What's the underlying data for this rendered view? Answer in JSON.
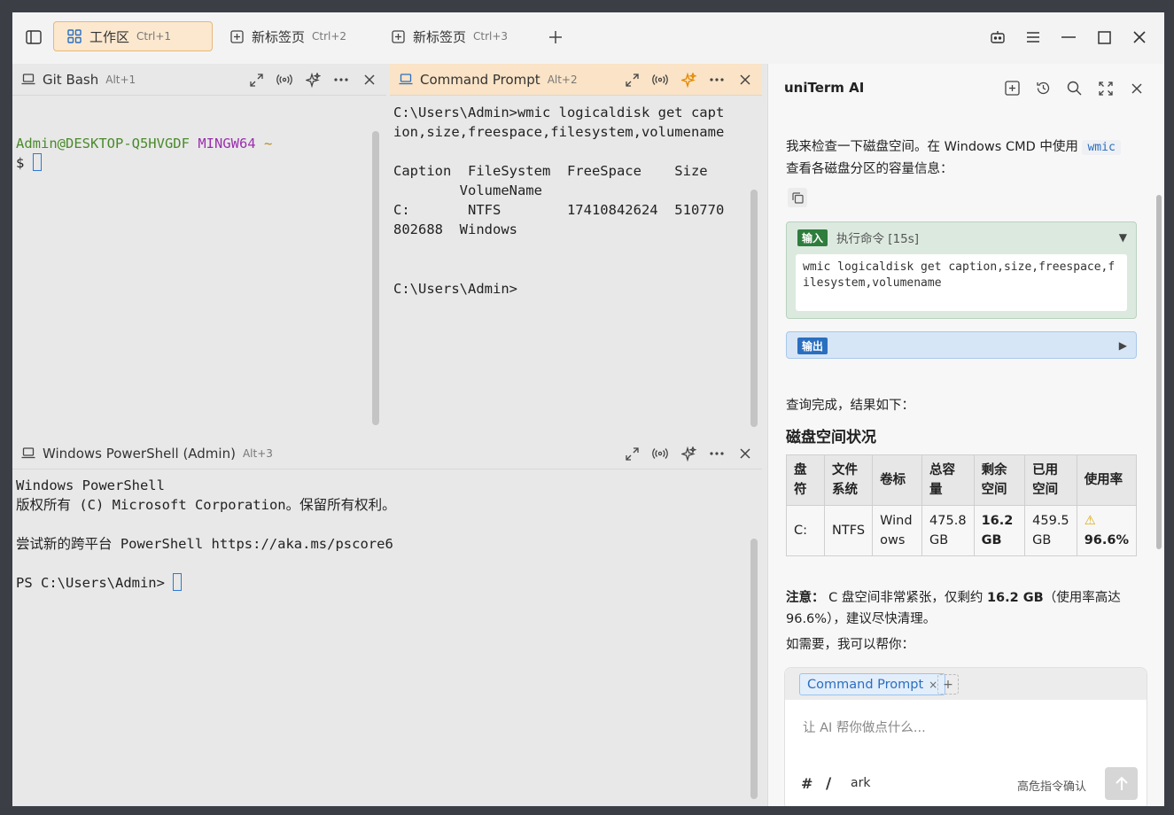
{
  "tabs": [
    {
      "label": "工作区",
      "shortcut": "Ctrl+1"
    },
    {
      "label": "新标签页",
      "shortcut": "Ctrl+2"
    },
    {
      "label": "新标签页",
      "shortcut": "Ctrl+3"
    }
  ],
  "panes": {
    "gitbash": {
      "title": "Git Bash",
      "shortcut": "Alt+1",
      "user": "Admin@DESKTOP-Q5HVGDF",
      "env": "MINGW64",
      "path": "~",
      "prompt": "$"
    },
    "cmd": {
      "title": "Command Prompt",
      "shortcut": "Alt+2",
      "lines": [
        "C:\\Users\\Admin>wmic logicaldisk get capt",
        "ion,size,freespace,filesystem,volumename",
        "",
        "Caption  FileSystem  FreeSpace    Size",
        "        VolumeName",
        "C:       NTFS        17410842624  510770",
        "802688  Windows",
        "",
        "",
        "C:\\Users\\Admin>"
      ]
    },
    "powershell": {
      "title": "Windows PowerShell (Admin)",
      "shortcut": "Alt+3",
      "lines": [
        "Windows PowerShell",
        "版权所有 (C) Microsoft Corporation。保留所有权利。",
        "",
        "尝试新的跨平台 PowerShell https://aka.ms/pscore6",
        ""
      ],
      "prompt": "PS C:\\Users\\Admin> "
    }
  },
  "ai": {
    "title": "uniTerm AI",
    "intro_a": "我来检查一下磁盘空间。在 Windows CMD 中使用",
    "intro_code": "wmic",
    "intro_b": "查看各磁盘分区的容量信息：",
    "input_badge": "输入",
    "input_label": "执行命令 [15s]",
    "command_text": "wmic logicaldisk get caption,size,freespace,filesystem,volumename",
    "output_badge": "输出",
    "done_text": "查询完成，结果如下：",
    "section_title": "磁盘空间状况",
    "table": {
      "headers": [
        "盘符",
        "文件系统",
        "卷标",
        "总容量",
        "剩余空间",
        "已用空间",
        "使用率"
      ],
      "row": [
        "C:",
        "NTFS",
        "Windows",
        "475.8 GB",
        "16.2 GB",
        "459.5 GB",
        "96.6%"
      ]
    },
    "note_label": "注意：",
    "note_a": "C 盘空间非常紧张，仅剩约",
    "note_bold": "16.2 GB",
    "note_b": "（使用率高达 96.6%），建议尽快清理。",
    "help_text": "如需要，我可以帮你：",
    "chip_label": "Command Prompt",
    "chip_add": "+",
    "input_placeholder": "让 AI 帮你做点什么...",
    "footer_hash": "#",
    "footer_slash": "/",
    "footer_model": "ark",
    "footer_confirm": "高危指令确认"
  },
  "colors": {
    "accent": "#e6b979",
    "green": "#4a8a2c",
    "purple": "#9b2fae"
  }
}
